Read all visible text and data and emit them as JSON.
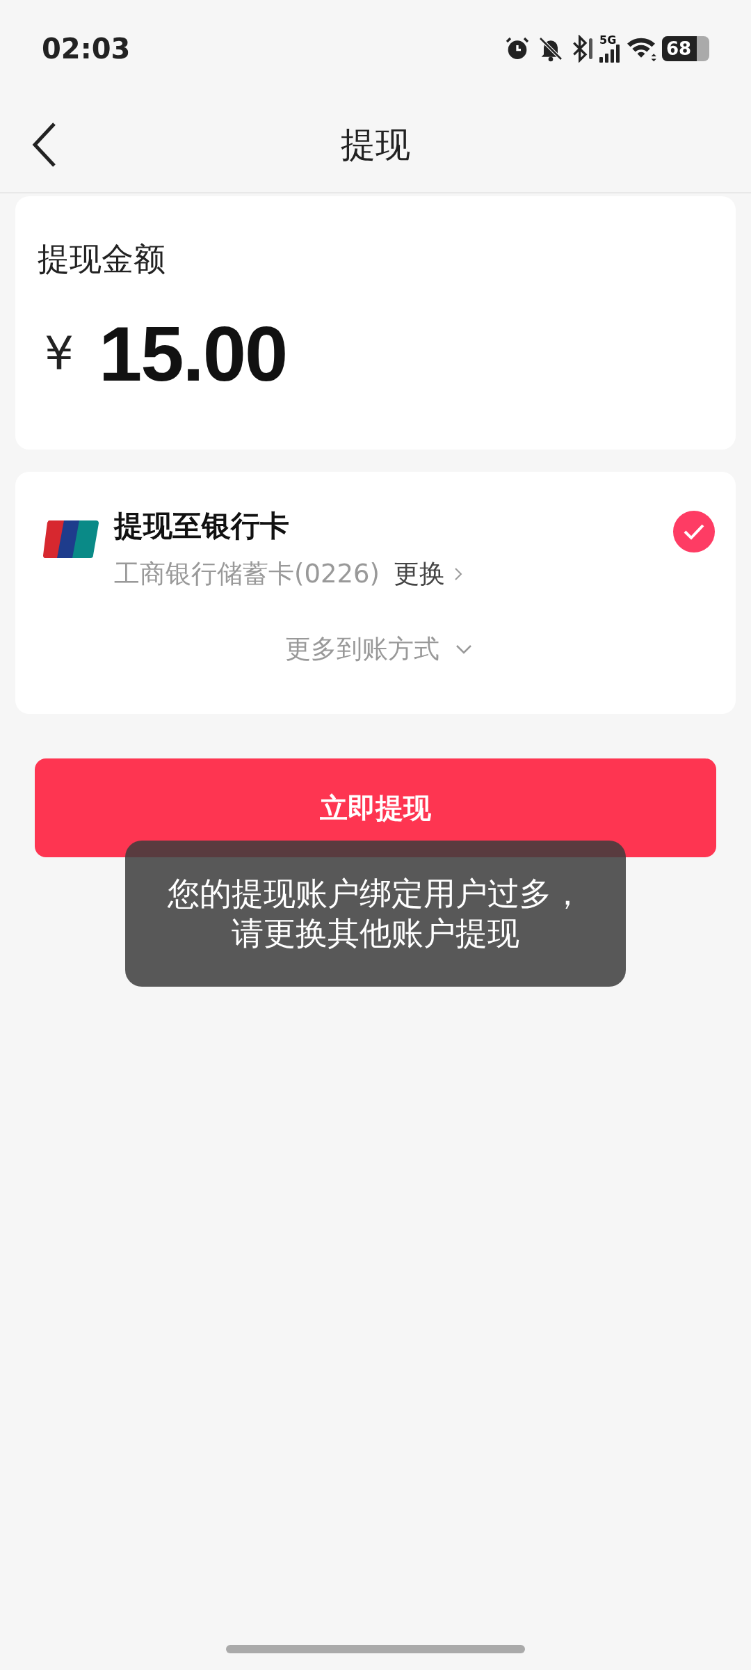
{
  "status_bar": {
    "time": "02:03",
    "network": "5G",
    "battery": "68"
  },
  "nav": {
    "title": "提现"
  },
  "amount_card": {
    "label": "提现金额",
    "currency": "¥",
    "amount": "15.00"
  },
  "method_card": {
    "title": "提现至银行卡",
    "account": "工商银行储蓄卡(0226)",
    "change": "更换",
    "selected": true,
    "more": "更多到账方式"
  },
  "submit_button": "立即提现",
  "toast": {
    "lines": [
      "您的提现账户绑定用户过多，",
      "请更换其他账户提现"
    ]
  }
}
